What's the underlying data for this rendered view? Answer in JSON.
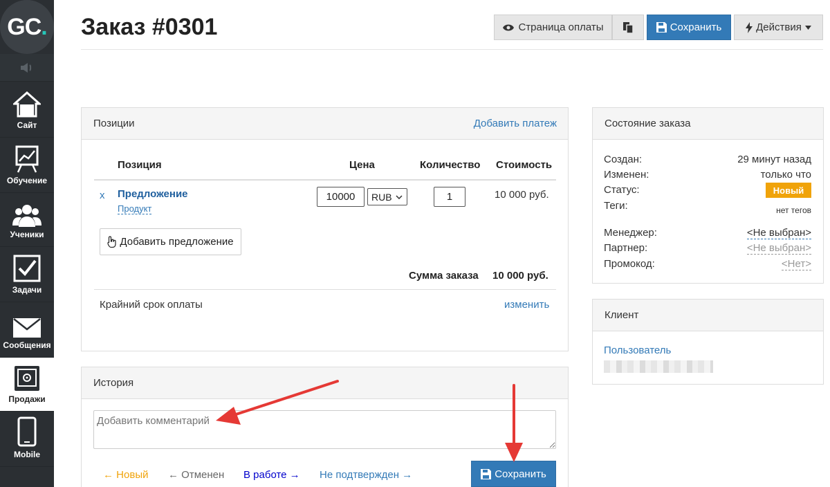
{
  "sidebar": {
    "logo_text": "GC",
    "logo_dot": ".",
    "items": [
      {
        "label": "Сайт",
        "icon": "house-icon"
      },
      {
        "label": "Обучение",
        "icon": "chart-board-icon"
      },
      {
        "label": "Ученики",
        "icon": "users-icon"
      },
      {
        "label": "Задачи",
        "icon": "checkbox-icon"
      },
      {
        "label": "Сообщения",
        "icon": "envelope-icon"
      },
      {
        "label": "Продажи",
        "icon": "safe-icon"
      },
      {
        "label": "Mobile",
        "icon": "phone-icon"
      }
    ],
    "active": "Продажи"
  },
  "header": {
    "title": "Заказ #0301",
    "payment_page_label": "Страница оплаты",
    "save_label": "Сохранить",
    "actions_label": "Действия"
  },
  "positions": {
    "title": "Позиции",
    "add_payment_link": "Добавить платеж",
    "columns": [
      "Позиция",
      "Цена",
      "Количество",
      "Стоимость"
    ],
    "items": [
      {
        "remove": "x",
        "name": "Предложение",
        "type": "Продукт",
        "price": "10000",
        "currency": "RUB",
        "quantity": "1",
        "cost": "10 000 руб."
      }
    ],
    "add_offer_label": "Добавить предложение",
    "total_label": "Сумма заказа",
    "total_value": "10 000 руб.",
    "deadline_label": "Крайний срок оплаты",
    "deadline_change": "изменить"
  },
  "order_state": {
    "title": "Состояние заказа",
    "created_label": "Создан:",
    "created_value": "29 минут назад",
    "modified_label": "Изменен:",
    "modified_value": "только что",
    "status_label": "Статус:",
    "status_value": "Новый",
    "tags_label": "Теги:",
    "tags_value": "нет тегов",
    "manager_label": "Менеджер:",
    "manager_value": "<Не выбран>",
    "partner_label": "Партнер:",
    "partner_value": "<Не выбран>",
    "promo_label": "Промокод:",
    "promo_value": "<Нет>"
  },
  "client": {
    "title": "Клиент",
    "user_link": "Пользователь"
  },
  "history": {
    "title": "История",
    "comment_placeholder": "Добавить комментарий",
    "statuses": [
      {
        "label": "Новый",
        "prefix": "← ",
        "suffix": "",
        "color": "#f0a30a"
      },
      {
        "label": "Отменен",
        "prefix": "← ",
        "suffix": "",
        "color": "#666666"
      },
      {
        "label": "В работе",
        "prefix": "",
        "suffix": " →",
        "color": "#0000cc"
      },
      {
        "label": "Не подтвержден",
        "prefix": "",
        "suffix": " →",
        "color": "#337ab7"
      }
    ],
    "save_label": "Сохранить"
  },
  "colors": {
    "primary": "#337ab7",
    "status_new": "#f0a30a",
    "annotation_arrow": "#e53935"
  }
}
